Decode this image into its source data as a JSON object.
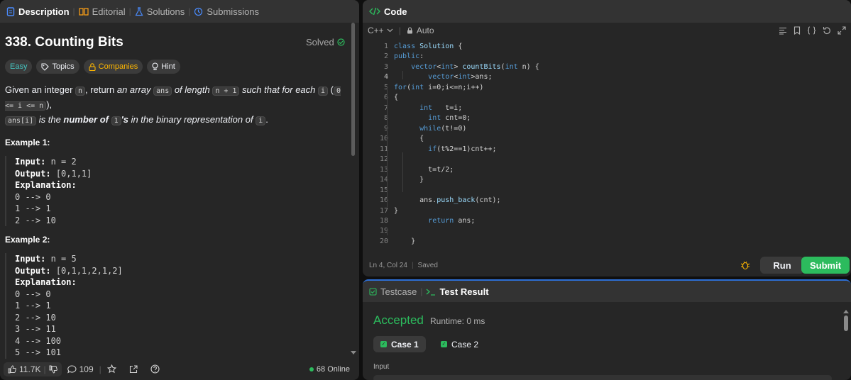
{
  "left_tabs": {
    "description": "Description",
    "editorial": "Editorial",
    "solutions": "Solutions",
    "submissions": "Submissions"
  },
  "problem": {
    "title": "338. Counting Bits",
    "status": "Solved",
    "tags": {
      "difficulty": "Easy",
      "topics": "Topics",
      "companies": "Companies",
      "hint": "Hint"
    },
    "desc": {
      "t1": "Given an integer ",
      "n": "n",
      "t2": ", return ",
      "t3": "an array ",
      "ans": "ans",
      "t4": " of length ",
      "n1": "n + 1",
      "t5": " such that for each ",
      "i": "i",
      "t6": " (",
      "range": "0 <= i <= n",
      "t7": "),",
      "ansi": "ans[i]",
      "t8": " is the ",
      "t9": "number of ",
      "one": "1",
      "t10": "'s",
      "t11": " in the binary representation of ",
      "i2": "i",
      "t12": "."
    },
    "examples": [
      {
        "heading": "Example 1:",
        "input_label": "Input:",
        "input": "n = 2",
        "output_label": "Output:",
        "output": "[0,1,1]",
        "explanation_label": "Explanation:",
        "lines": [
          "0 --> 0",
          "1 --> 1",
          "2 --> 10"
        ]
      },
      {
        "heading": "Example 2:",
        "input_label": "Input:",
        "input": "n = 5",
        "output_label": "Output:",
        "output": "[0,1,1,2,1,2]",
        "explanation_label": "Explanation:",
        "lines": [
          "0 --> 0",
          "1 --> 1",
          "2 --> 10",
          "3 --> 11",
          "4 --> 100",
          "5 --> 101"
        ]
      }
    ]
  },
  "left_footer": {
    "likes": "11.7K",
    "comments": "109",
    "online": "68 Online"
  },
  "code_panel": {
    "title": "Code",
    "language": "C++",
    "mode": "Auto",
    "lines": [
      {
        "n": "1",
        "text": "class Solution {"
      },
      {
        "n": "2",
        "text": "public:"
      },
      {
        "n": "3",
        "text": "    vector<int> countBits(int n) {"
      },
      {
        "n": "4",
        "text": "        vector<int>ans;"
      },
      {
        "n": "5",
        "text": "for(int i=0;i<=n;i++)"
      },
      {
        "n": "6",
        "text": "{"
      },
      {
        "n": "7",
        "text": "      int   t=i;"
      },
      {
        "n": "8",
        "text": "        int cnt=0;"
      },
      {
        "n": "9",
        "text": "      while(t!=0)"
      },
      {
        "n": "10",
        "text": "      {"
      },
      {
        "n": "11",
        "text": "        if(t%2==1)cnt++;"
      },
      {
        "n": "12",
        "text": ""
      },
      {
        "n": "13",
        "text": "        t=t/2;"
      },
      {
        "n": "14",
        "text": "      }"
      },
      {
        "n": "15",
        "text": ""
      },
      {
        "n": "16",
        "text": "      ans.push_back(cnt);"
      },
      {
        "n": "17",
        "text": "}"
      },
      {
        "n": "18",
        "text": "        return ans;"
      },
      {
        "n": "19",
        "text": ""
      },
      {
        "n": "20",
        "text": "    }"
      }
    ],
    "cursor": "Ln 4, Col 24",
    "saved": "Saved",
    "run": "Run",
    "submit": "Submit"
  },
  "result_panel": {
    "tab_testcase": "Testcase",
    "tab_result": "Test Result",
    "status": "Accepted",
    "runtime": "Runtime: 0 ms",
    "case1": "Case 1",
    "case2": "Case 2",
    "input_label": "Input"
  },
  "colors": {
    "accent_green": "#2cbb5d",
    "easy": "#46c6c2",
    "companies": "#ffb700",
    "link_blue": "#2d6fd6"
  }
}
